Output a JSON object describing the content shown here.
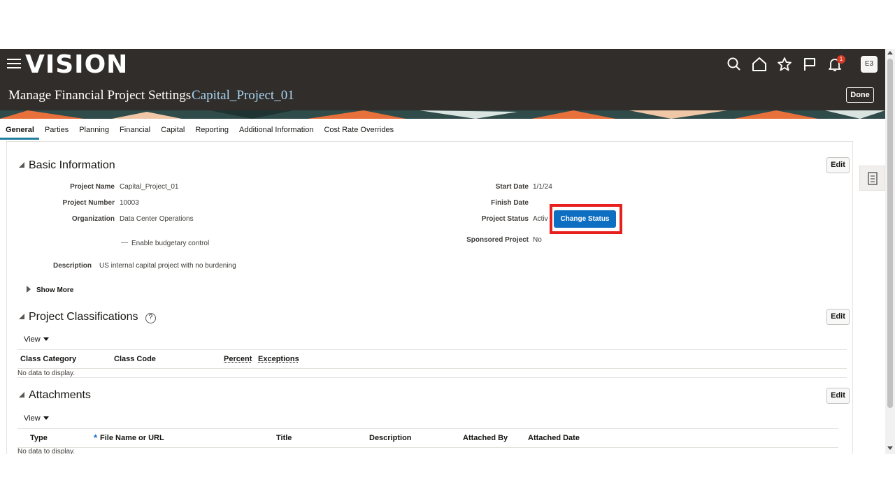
{
  "app": {
    "logo": "vision"
  },
  "header": {
    "title": "Manage Financial Project Settings",
    "subtitle": "Capital_Project_01",
    "done_label": "Done",
    "notification_count": "1",
    "user_initials": "E3"
  },
  "tabs": [
    {
      "label": "General",
      "active": true
    },
    {
      "label": "Parties"
    },
    {
      "label": "Planning"
    },
    {
      "label": "Financial"
    },
    {
      "label": "Capital"
    },
    {
      "label": "Reporting"
    },
    {
      "label": "Additional Information"
    },
    {
      "label": "Cost Rate Overrides"
    }
  ],
  "basic": {
    "title": "Basic Information",
    "edit_label": "Edit",
    "project_name_label": "Project Name",
    "project_name": "Capital_Project_01",
    "project_number_label": "Project Number",
    "project_number": "10003",
    "organization_label": "Organization",
    "organization": "Data Center Operations",
    "budgetary_label": "Enable budgetary control",
    "description_label": "Description",
    "description": "US internal capital project with no burdening",
    "start_date_label": "Start Date",
    "start_date": "1/1/24",
    "finish_date_label": "Finish Date",
    "finish_date": "",
    "project_status_label": "Project Status",
    "project_status": "Activ",
    "change_status_label": "Change Status",
    "sponsored_label": "Sponsored Project",
    "sponsored": "No",
    "show_more_label": "Show More"
  },
  "classifications": {
    "title": "Project Classifications",
    "edit_label": "Edit",
    "view_label": "View",
    "columns": [
      "Class Category",
      "Class Code",
      "Percent",
      "Exceptions"
    ],
    "empty_text": "No data to display."
  },
  "attachments": {
    "title": "Attachments",
    "edit_label": "Edit",
    "view_label": "View",
    "required_mark": "*",
    "columns": [
      "Type",
      "File Name or URL",
      "Title",
      "Description",
      "Attached By",
      "Attached Date"
    ],
    "empty_text": "No data to display."
  },
  "colors": {
    "header_bg": "#312d2a",
    "accent": "#0d6ec2",
    "highlight": "#e8201d",
    "subtitle": "#a6d3f0"
  }
}
